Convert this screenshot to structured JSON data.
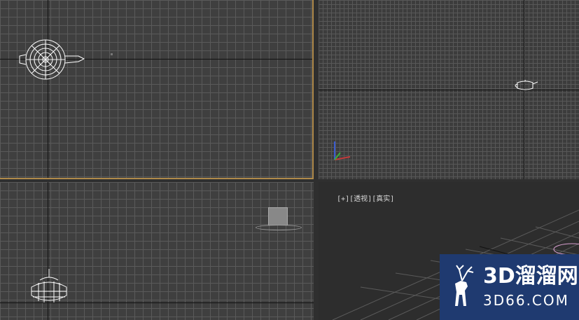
{
  "viewports": {
    "perspective": {
      "label_plus": "[+]",
      "label_view": "[透视]",
      "label_shading": "[真实]"
    }
  },
  "watermark": {
    "brand_cn": "3D溜溜网",
    "brand_url": "3D66.COM"
  },
  "colors": {
    "active_border": "#b08a4a",
    "watermark_bg": "#1f3a70",
    "grid_line": "#5a5a5a",
    "viewport_bg": "#3f3f3f",
    "persp_bg": "#2d2d2d"
  },
  "icons": [
    "teapot-icon",
    "view-cube-icon",
    "axis-tripod-icon",
    "deer-logo-icon"
  ]
}
